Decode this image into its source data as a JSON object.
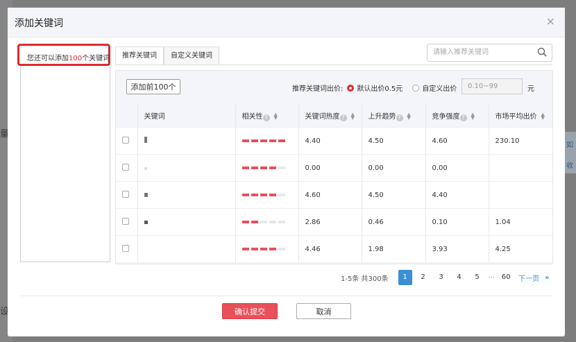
{
  "background": {
    "left_chars": [
      "量",
      "设置"
    ],
    "right_chars": [
      "如",
      "收"
    ]
  },
  "dialog": {
    "title": "添加关键词",
    "close": "×"
  },
  "quota": {
    "prefix": "您还可以添加",
    "count": "100",
    "suffix": "个关键词"
  },
  "tabs": [
    {
      "label": "推荐关键词",
      "active": true
    },
    {
      "label": "自定义关键词",
      "active": false
    }
  ],
  "search": {
    "placeholder": "请输入推荐关键词",
    "value": ""
  },
  "toolbar": {
    "add_top_label": "添加前100个",
    "bid_label": "推荐关键词出价:",
    "default_bid": "默认出价0.5元",
    "custom_bid": "自定义出价",
    "bid_placeholder": "0.10~99",
    "unit": "元"
  },
  "table": {
    "headers": [
      "关键词",
      "相关性",
      "关键词热度",
      "上升趋势",
      "竞争强度",
      "市场平均出价"
    ],
    "rows": [
      {
        "relevance": 5,
        "heat": "4.40",
        "trend": "4.50",
        "competition": "4.60",
        "avg_bid": "230.10"
      },
      {
        "relevance": 4,
        "heat": "0.00",
        "trend": "0.00",
        "competition": "0.00",
        "avg_bid": ""
      },
      {
        "relevance": 4,
        "heat": "4.60",
        "trend": "4.50",
        "competition": "4.40",
        "avg_bid": ""
      },
      {
        "relevance": 2,
        "heat": "2.86",
        "trend": "0.46",
        "competition": "0.10",
        "avg_bid": "1.04"
      },
      {
        "relevance": 4,
        "heat": "4.46",
        "trend": "1.98",
        "competition": "3.93",
        "avg_bid": "4.25"
      }
    ]
  },
  "pagination": {
    "summary": "1-5条 共300条",
    "pages": [
      "1",
      "2",
      "3",
      "4",
      "5"
    ],
    "current": 1,
    "ellipsis": "···",
    "last": "60",
    "next": "下一页",
    "next_arrow": "»"
  },
  "footer": {
    "confirm": "确认提交",
    "cancel": "取消"
  },
  "colors": {
    "accent_red": "#e0282e",
    "relevance_on": "#e8505a",
    "page_active": "#3b8fd6"
  }
}
